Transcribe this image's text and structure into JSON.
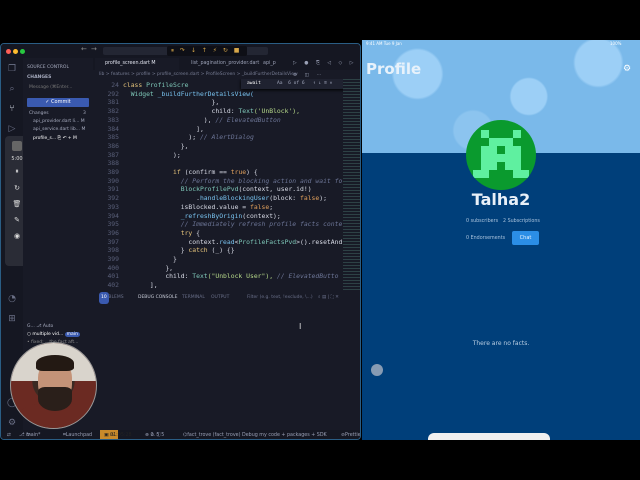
{
  "ide": {
    "side_title": "SOURCE CONTROL",
    "changes_header": "CHANGES",
    "message_placeholder": "Message (⌘Enter...",
    "commit_label": "✓ Commit",
    "changes_group": "Changes",
    "changes_count": "3",
    "files": [
      {
        "name": "api_provider.dart",
        "path": "li...",
        "status": "M"
      },
      {
        "name": "api_service.dart",
        "path": "lib...",
        "status": "M"
      },
      {
        "name": "profile_s...",
        "path": "",
        "status": "M"
      }
    ],
    "tabs": [
      {
        "label": "profile_screen.dart M"
      },
      {
        "label": "list_pagination_provider.dart"
      },
      {
        "label": "api_p"
      }
    ],
    "breadcrumb": "lib > features > profile > profile_screen.dart > ProfileScreen > _buildFurtherDetailsView",
    "find": {
      "query": "await",
      "count": "6 of 6",
      "case": "Aa"
    },
    "code_lines": [
      {
        "n": "24",
        "s": [
          [
            "class ",
            "kw"
          ],
          [
            "ProfileScre",
            "cls"
          ]
        ]
      },
      {
        "n": "292",
        "s": [
          [
            "  Widget ",
            "cls"
          ],
          [
            "_buildFurtherDetailsView(",
            "fn"
          ]
        ]
      },
      {
        "n": "381",
        "s": [
          [
            "                       },",
            ""
          ]
        ]
      },
      {
        "n": "382",
        "s": [
          [
            "                       child: ",
            ""
          ],
          [
            "Text",
            "cls"
          ],
          [
            "('UnBlock'),",
            "str"
          ]
        ]
      },
      {
        "n": "383",
        "s": [
          [
            "                     ), ",
            ""
          ],
          [
            "// ElevatedButton",
            "cm"
          ]
        ]
      },
      {
        "n": "384",
        "s": [
          [
            "                   ],",
            ""
          ]
        ]
      },
      {
        "n": "385",
        "s": [
          [
            "                 ); ",
            ""
          ],
          [
            "// AlertDialog",
            "cm"
          ]
        ]
      },
      {
        "n": "386",
        "s": [
          [
            "               },",
            ""
          ]
        ]
      },
      {
        "n": "387",
        "s": [
          [
            "             );",
            ""
          ]
        ]
      },
      {
        "n": "388",
        "s": [
          [
            "",
            ""
          ]
        ]
      },
      {
        "n": "389",
        "s": [
          [
            "             ",
            ""
          ],
          [
            "if ",
            "kw"
          ],
          [
            "(confirm == ",
            ""
          ],
          [
            "true",
            "bl"
          ],
          [
            ") {",
            ""
          ]
        ]
      },
      {
        "n": "390",
        "s": [
          [
            "               ",
            ""
          ],
          [
            "// Perform the blocking action and wait fo",
            "cm"
          ]
        ]
      },
      {
        "n": "391",
        "s": [
          [
            "               ",
            ""
          ],
          [
            "BlockProfilePvd",
            "cls"
          ],
          [
            "(context, user.id!)",
            ""
          ]
        ]
      },
      {
        "n": "392",
        "s": [
          [
            "                   .",
            ""
          ],
          [
            "handleBlockingUser",
            "fn"
          ],
          [
            "(block: ",
            ""
          ],
          [
            "false",
            "bl"
          ],
          [
            ");",
            ""
          ]
        ]
      },
      {
        "n": "393",
        "s": [
          [
            "               isBlocked.value = ",
            ""
          ],
          [
            "false",
            "bl"
          ],
          [
            ";",
            ""
          ]
        ]
      },
      {
        "n": "394",
        "s": [
          [
            "               ",
            ""
          ],
          [
            "_refreshByOrigin",
            "fn"
          ],
          [
            "(context);",
            ""
          ]
        ]
      },
      {
        "n": "395",
        "s": [
          [
            "               ",
            ""
          ],
          [
            "// Immediately refresh profile facts conte",
            "cm"
          ]
        ]
      },
      {
        "n": "396",
        "s": [
          [
            "               ",
            ""
          ],
          [
            "try ",
            "kw"
          ],
          [
            "{",
            ""
          ]
        ]
      },
      {
        "n": "397",
        "s": [
          [
            "                 context.",
            ""
          ],
          [
            "read",
            "fn"
          ],
          [
            "<",
            ""
          ],
          [
            "ProfileFactsPvd",
            "cls"
          ],
          [
            ">().resetAnd",
            ""
          ]
        ]
      },
      {
        "n": "398",
        "s": [
          [
            "               } ",
            ""
          ],
          [
            "catch ",
            "kw"
          ],
          [
            "(_) {}",
            ""
          ]
        ]
      },
      {
        "n": "399",
        "s": [
          [
            "             }",
            ""
          ]
        ]
      },
      {
        "n": "400",
        "s": [
          [
            "           },",
            ""
          ]
        ]
      },
      {
        "n": "401",
        "s": [
          [
            "           child: ",
            ""
          ],
          [
            "Text",
            "cls"
          ],
          [
            "(\"Unblock User\"), ",
            "str"
          ],
          [
            "// ElevatedButto",
            "cm"
          ]
        ]
      },
      {
        "n": "402",
        "s": [
          [
            "       ],",
            ""
          ]
        ]
      }
    ],
    "panel": {
      "problems": "PROBLEMS",
      "problems_count": "10",
      "debug": "DEBUG CONSOLE",
      "terminal": "TERMINAL",
      "output": "OUTPUT",
      "filter_placeholder": "Filter (e.g. text, !exclude, \\...)"
    },
    "graph": {
      "header": "G...",
      "auto": "Auto",
      "commit1": "multiple vid...",
      "branch": "main",
      "commit2": "fixed:  ...the fact aft...",
      "gitlens": "GITLENS"
    },
    "status": {
      "branch": "main*",
      "launchpad": "Launchpad",
      "timer": "01:05:28",
      "errors": "0",
      "warnings": "5",
      "info": "5",
      "device": "fact_trove (fact_trove)",
      "debug": "Debug my code + packages + SDK",
      "prettier": "Prettier"
    },
    "rec_time": "5:00"
  },
  "phone": {
    "time": "9:41 AM  Tue 9 Jan",
    "battery": "100%",
    "title": "Profile",
    "username": "Talha2",
    "subscribers": "0 subscribers",
    "subscriptions": "2 Subscriptions",
    "endorsements": "0 Endorsements",
    "chat_label": "Chat",
    "empty": "There are no facts."
  },
  "colors": {
    "accent": "#2b8ee6",
    "phone_bg": "#003f7a",
    "avatar": "#0a9a2e",
    "ide_bg": "#181a26"
  }
}
